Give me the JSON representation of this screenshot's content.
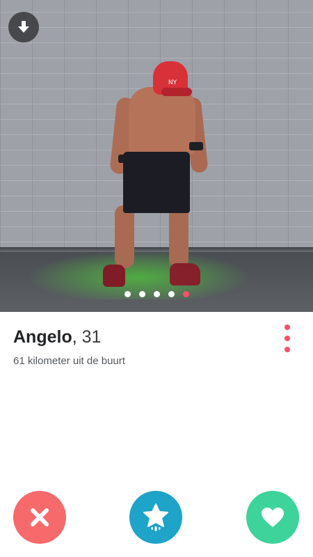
{
  "profile": {
    "name": "Angelo",
    "age_separator": ",",
    "age": "31",
    "distance": "61 kilometer uit de buurt"
  },
  "photo": {
    "count": 5,
    "active_index": 4,
    "cap_text": "NY"
  },
  "actions": {
    "nope_icon": "close-icon",
    "super_like_icon": "star-icon",
    "like_icon": "heart-icon"
  },
  "colors": {
    "accent": "#fd5068",
    "nope": "#f76a6b",
    "super_like": "#1ea3c9",
    "like": "#3dd39b"
  }
}
